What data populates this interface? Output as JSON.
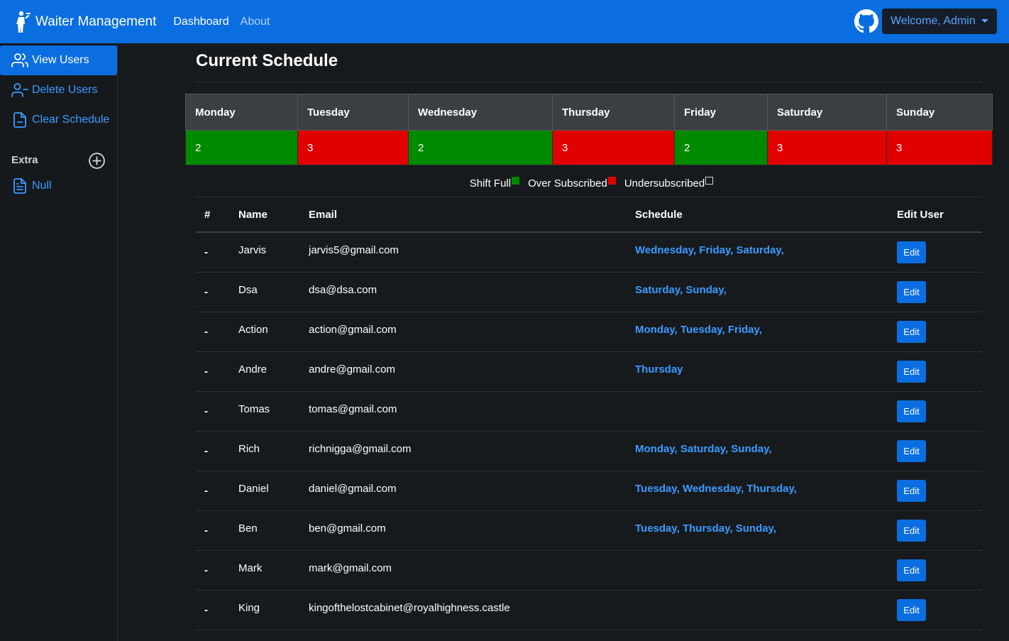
{
  "navbar": {
    "brand": "Waiter Management",
    "links": [
      "Dashboard",
      "About"
    ],
    "welcome": "Welcome, Admin",
    "brand_icon": "waiter-icon",
    "github_icon": "github-icon",
    "color": "#0a6ee0"
  },
  "sidebar": {
    "items": [
      {
        "label": "View Users",
        "icon": "users-icon",
        "active": true
      },
      {
        "label": "Delete Users",
        "icon": "user-minus-icon",
        "active": false
      },
      {
        "label": "Clear Schedule",
        "icon": "file-icon",
        "active": false
      }
    ],
    "extra_heading": "Extra",
    "extra_items": [
      {
        "label": "Null",
        "icon": "file-text-icon"
      }
    ]
  },
  "main": {
    "title": "Current Schedule",
    "schedule": {
      "days": [
        "Monday",
        "Tuesday",
        "Wednesday",
        "Thursday",
        "Friday",
        "Saturday",
        "Sunday"
      ],
      "counts": [
        "2",
        "3",
        "2",
        "3",
        "2",
        "3",
        "3"
      ],
      "status": [
        "full",
        "over",
        "full",
        "over",
        "full",
        "over",
        "over"
      ]
    },
    "legend": {
      "full": "Shift Full",
      "over": "Over Subscribed",
      "under": "Undersubscribed",
      "colors": {
        "full": "#008a00",
        "over": "#e00000"
      }
    },
    "users_table": {
      "headers": [
        "#",
        "Name",
        "Email",
        "Schedule",
        "Edit User"
      ],
      "edit_label": "Edit",
      "rows": [
        {
          "num": "-",
          "name": "Jarvis",
          "email": "jarvis5@gmail.com",
          "schedule": "Wednesday, Friday, Saturday,"
        },
        {
          "num": "-",
          "name": "Dsa",
          "email": "dsa@dsa.com",
          "schedule": "Saturday, Sunday,"
        },
        {
          "num": "-",
          "name": "Action",
          "email": "action@gmail.com",
          "schedule": "Monday, Tuesday, Friday,"
        },
        {
          "num": "-",
          "name": "Andre",
          "email": "andre@gmail.com",
          "schedule": "Thursday"
        },
        {
          "num": "-",
          "name": "Tomas",
          "email": "tomas@gmail.com",
          "schedule": ""
        },
        {
          "num": "-",
          "name": "Rich",
          "email": "richnigga@gmail.com",
          "schedule": "Monday, Saturday, Sunday,"
        },
        {
          "num": "-",
          "name": "Daniel",
          "email": "daniel@gmail.com",
          "schedule": "Tuesday, Wednesday, Thursday,"
        },
        {
          "num": "-",
          "name": "Ben",
          "email": "ben@gmail.com",
          "schedule": "Tuesday, Thursday, Sunday,"
        },
        {
          "num": "-",
          "name": "Mark",
          "email": "mark@gmail.com",
          "schedule": ""
        },
        {
          "num": "-",
          "name": "King",
          "email": "kingofthelostcabinet@royalhighness.castle",
          "schedule": ""
        }
      ]
    }
  }
}
